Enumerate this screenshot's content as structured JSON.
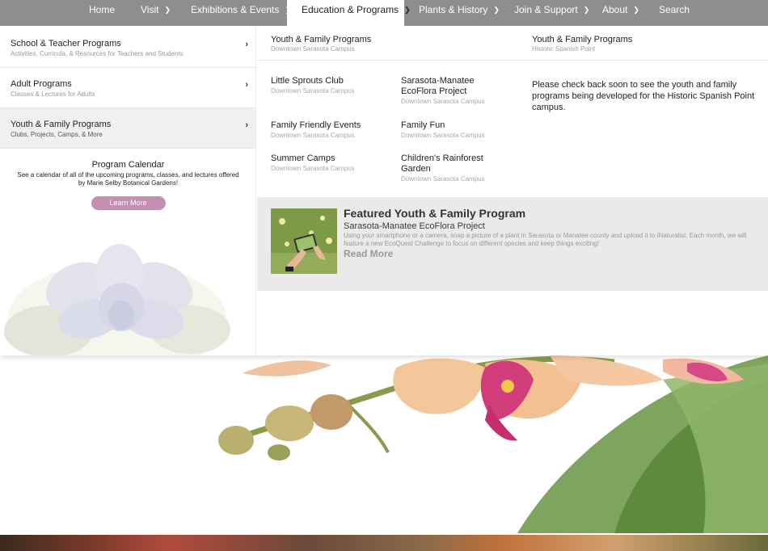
{
  "nav": {
    "home": "Home",
    "visit": "Visit",
    "exhibitions": "Exhibitions & Events",
    "education": "Education & Programs",
    "plants": "Plants & History",
    "join": "Join & Support",
    "about": "About",
    "search": "Search",
    "chevron_icon": "chevron-down-icon"
  },
  "categories": [
    {
      "title": "School & Teacher Programs",
      "subtitle": "Activities, Curricula, & Resources for Teachers and Students"
    },
    {
      "title": "Adult Programs",
      "subtitle": "Classes & Lectures for Adults"
    },
    {
      "title": "Youth & Family Programs",
      "subtitle": "Clubs, Projects, Camps, & More"
    }
  ],
  "calendar": {
    "title": "Program Calendar",
    "description": "See a calendar of all of the upcoming programs, classes, and lectures offered by Marie Selby Botanical Gardens!",
    "button": "Learn More"
  },
  "columns": {
    "downtown": {
      "title": "Youth & Family Programs",
      "subtitle": "Downtown Sarasota Campus"
    },
    "historic": {
      "title": "Youth & Family Programs",
      "subtitle": "Historic Spanish Point"
    }
  },
  "programs": [
    {
      "title": "Little Sprouts Club",
      "subtitle": "Downtown Sarasota Campus"
    },
    {
      "title": "Sarasota-Manatee EcoFlora Project",
      "subtitle": "Downtown Sarasota Campus"
    },
    {
      "title": "Family Friendly Events",
      "subtitle": "Downtown Sarasota Campus"
    },
    {
      "title": "Family Fun",
      "subtitle": "Downtown Sarasota Campus"
    },
    {
      "title": "Summer Camps",
      "subtitle": "Downtown Sarasota Campus"
    },
    {
      "title": "Children's Rainforest Garden",
      "subtitle": "Downtown Sarasota Campus"
    }
  ],
  "historic_note": "Please check back soon to see the youth and family programs being developed for the Historic Spanish Point campus.",
  "featured": {
    "heading": "Featured Youth & Family Program",
    "name": "Sarasota-Manatee EcoFlora Project",
    "description": "Using your smartphone or a camera, snap a picture of a plant in Sarasota or Manatee county and upload it to iNaturalist. Each month, we will feature a new EcoQuest Challenge to focus on different species and keep things exciting!",
    "read_more": "Read More"
  },
  "colors": {
    "nav_bg": "#8e8e8e",
    "button_pink": "#c58fb2",
    "featured_bg": "#eaeaea"
  }
}
